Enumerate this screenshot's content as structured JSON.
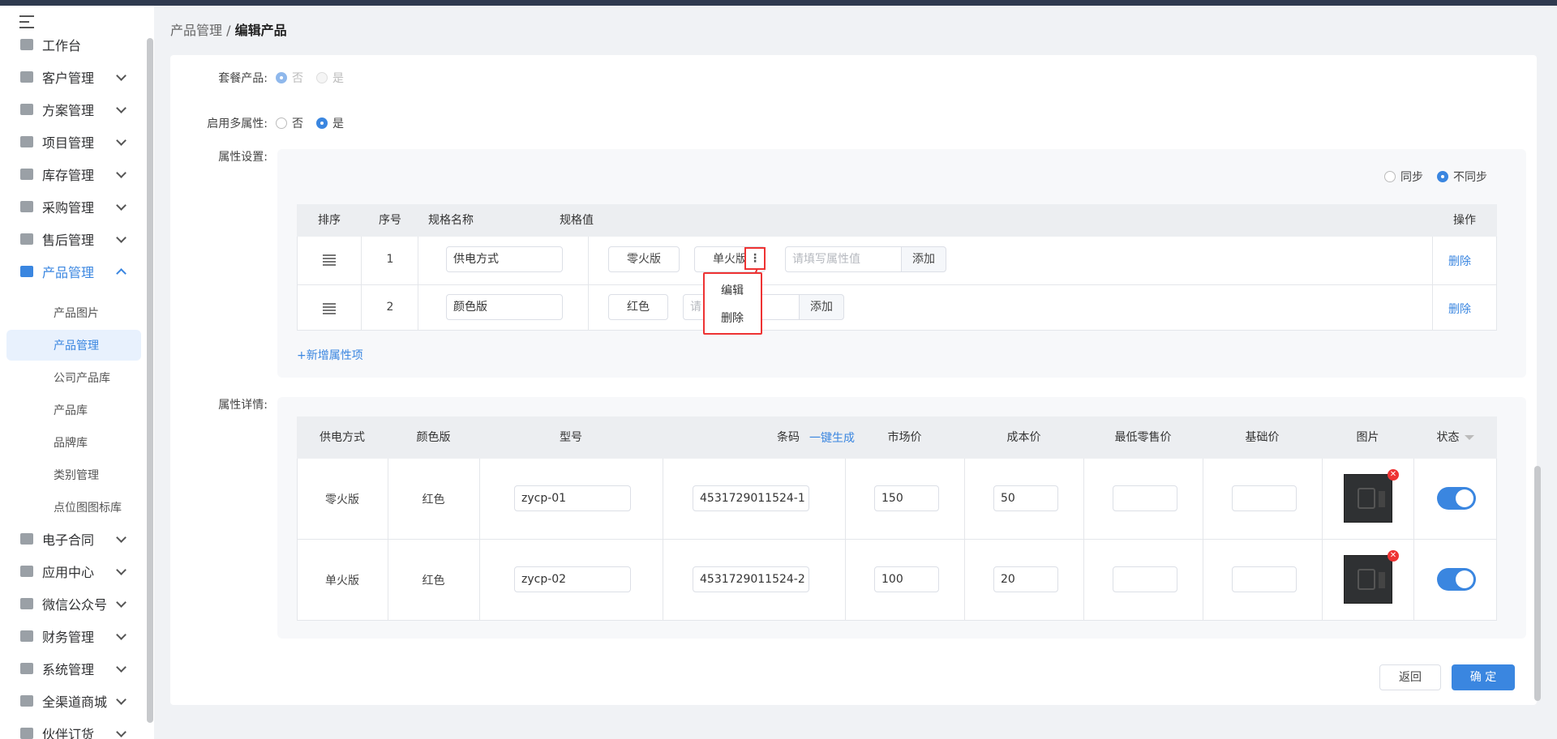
{
  "sidebar": {
    "items": [
      {
        "label": "工作台",
        "icon": "home-icon"
      },
      {
        "label": "客户管理",
        "icon": "customer-icon"
      },
      {
        "label": "方案管理",
        "icon": "document-icon"
      },
      {
        "label": "项目管理",
        "icon": "folder-icon"
      },
      {
        "label": "库存管理",
        "icon": "inventory-icon"
      },
      {
        "label": "采购管理",
        "icon": "cart-icon"
      },
      {
        "label": "售后管理",
        "icon": "headset-icon"
      },
      {
        "label": "产品管理",
        "icon": "product-icon"
      },
      {
        "label": "电子合同",
        "icon": "contract-icon"
      },
      {
        "label": "应用中心",
        "icon": "apps-icon"
      },
      {
        "label": "微信公众号",
        "icon": "wechat-icon"
      },
      {
        "label": "财务管理",
        "icon": "finance-icon"
      },
      {
        "label": "系统管理",
        "icon": "settings-icon"
      },
      {
        "label": "全渠道商城",
        "icon": "mall-icon"
      },
      {
        "label": "伙伴订货",
        "icon": "partner-icon"
      }
    ],
    "product_sub": [
      "产品图片",
      "产品管理",
      "公司产品库",
      "产品库",
      "品牌库",
      "类别管理",
      "点位图图标库"
    ]
  },
  "breadcrumb": {
    "parent": "产品管理",
    "sep": "/",
    "current": "编辑产品"
  },
  "form": {
    "package_label": "套餐产品:",
    "package_no": "否",
    "package_yes": "是",
    "multi_label": "启用多属性:",
    "multi_no": "否",
    "multi_yes": "是",
    "attr_settings_label": "属性设置:",
    "attr_details_label": "属性详情:",
    "sync": "同步",
    "nosync": "不同步"
  },
  "spec_table": {
    "headers": [
      "排序",
      "序号",
      "规格名称",
      "规格值",
      "操作"
    ],
    "rows": [
      {
        "index": "1",
        "name": "供电方式",
        "values": [
          "零火版",
          "单火版"
        ],
        "placeholder": "请填写属性值",
        "add": "添加",
        "delete": "删除"
      },
      {
        "index": "2",
        "name": "颜色版",
        "values": [
          "红色"
        ],
        "placeholder": "请",
        "add": "添加",
        "delete": "删除"
      }
    ],
    "add_item": "+新增属性项",
    "context_menu": [
      "编辑",
      "删除"
    ],
    "more_glyph": "⋮"
  },
  "detail_table": {
    "headers": [
      "供电方式",
      "颜色版",
      "型号",
      "条码",
      "市场价",
      "成本价",
      "最低零售价",
      "基础价",
      "图片",
      "状态"
    ],
    "generate": "一键生成",
    "rows": [
      {
        "power": "零火版",
        "color": "红色",
        "model": "zycp-01",
        "barcode": "4531729011524-1",
        "market": "150",
        "cost": "50",
        "min": "",
        "base": "",
        "status": true
      },
      {
        "power": "单火版",
        "color": "红色",
        "model": "zycp-02",
        "barcode": "4531729011524-2",
        "market": "100",
        "cost": "20",
        "min": "",
        "base": "",
        "status": true
      }
    ]
  },
  "footer": {
    "back": "返回",
    "confirm": "确 定"
  },
  "colors": {
    "accent": "#3a86e0",
    "annotation": "#e33333"
  }
}
